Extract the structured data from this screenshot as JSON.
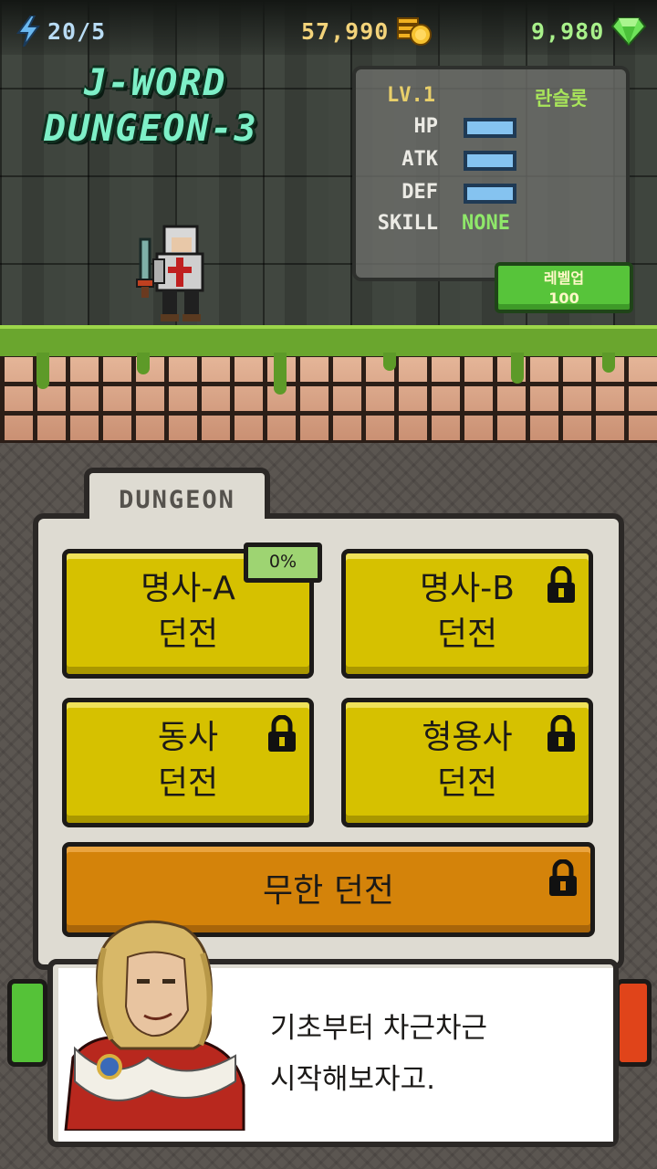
{
  "hud": {
    "energy": "20/5",
    "coins": "57,990",
    "gems": "9,980"
  },
  "title": {
    "line1": "J-WORD",
    "line2": "DUNGEON-3"
  },
  "player": {
    "level": "LV.1",
    "name": "란슬롯",
    "stats": [
      {
        "label": "HP"
      },
      {
        "label": "ATK"
      },
      {
        "label": "DEF"
      }
    ],
    "skill_label": "SKILL",
    "skill_value": "NONE"
  },
  "levelup": {
    "label": "레벨업",
    "cost": "100"
  },
  "dungeon_tab": "DUNGEON",
  "dungeons": [
    {
      "line1": "명사-A",
      "line2": "던전",
      "progress": "0%",
      "locked": false
    },
    {
      "line1": "명사-B",
      "line2": "던전",
      "locked": true
    },
    {
      "line1": "동사",
      "line2": "던전",
      "locked": true
    },
    {
      "line1": "형용사",
      "line2": "던전",
      "locked": true
    },
    {
      "line1": "무한 던전",
      "locked": true
    }
  ],
  "dialog": {
    "line1": "기초부터 차근차근",
    "line2": "시작해보자고."
  },
  "colors": {
    "dungeon_button": "#d6c100",
    "infinite_button": "#d4830a",
    "levelup_button": "#57c43a",
    "gem": "#6fe35a",
    "coin": "#f0b020"
  },
  "icons": [
    "lightning-icon",
    "coin-icon",
    "gem-icon",
    "lock-icon"
  ]
}
